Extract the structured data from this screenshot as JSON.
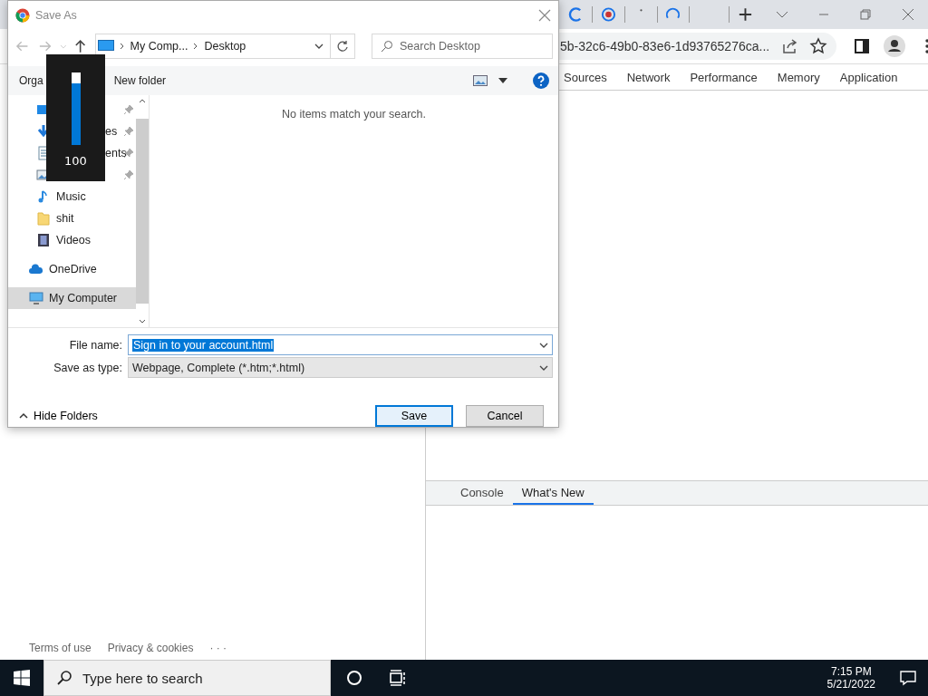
{
  "browser": {
    "url": "5b-32c6-49b0-83e6-1d93765276ca...",
    "devtools_tabs": [
      {
        "label": "Sources",
        "selected": false
      },
      {
        "label": "Network",
        "selected": false
      },
      {
        "label": "Performance",
        "selected": false
      },
      {
        "label": "Memory",
        "selected": false
      },
      {
        "label": "Application",
        "selected": false
      }
    ],
    "drawer_tabs": [
      {
        "label": "Console",
        "selected": false
      },
      {
        "label": "What's New",
        "selected": true
      }
    ],
    "footer_links": [
      "Terms of use",
      "Privacy & cookies",
      "· · ·"
    ]
  },
  "dialog": {
    "title": "Save As",
    "breadcrumb": [
      "My Comp...",
      "Desktop"
    ],
    "search": {
      "placeholder": "Search Desktop"
    },
    "toolbar": {
      "organize": "Orga",
      "new_folder": "New folder"
    },
    "nav_items": [
      {
        "kind": "desktop",
        "pinned": true,
        "selected": false
      },
      {
        "kind": "download",
        "label": "es",
        "pinned": true,
        "selected": false
      },
      {
        "kind": "document",
        "label": "ents",
        "pinned": true,
        "selected": false
      },
      {
        "kind": "pictures",
        "pinned": true,
        "selected": false
      },
      {
        "kind": "music",
        "label": "Music",
        "pinned": false,
        "selected": false
      },
      {
        "kind": "folder",
        "label": "shit",
        "pinned": false,
        "selected": false
      },
      {
        "kind": "videos",
        "label": "Videos",
        "pinned": false,
        "selected": false
      },
      {
        "kind": "cloud",
        "label": "OneDrive",
        "pinned": false,
        "selected": false
      },
      {
        "kind": "computer",
        "label": "My Computer",
        "pinned": false,
        "selected": true
      }
    ],
    "empty_message": "No items match your search.",
    "file_name_label": "File name:",
    "file_name": "Sign in to your account.html",
    "type_label": "Save as type:",
    "type_value": "Webpage, Complete (*.htm;*.html)",
    "hide_folders": "Hide Folders",
    "buttons": [
      "Save",
      "Cancel"
    ]
  },
  "volume": {
    "level": 1,
    "reading": "100"
  },
  "taskbar": {
    "search": {
      "placeholder": "Type here to search"
    },
    "time": "7:15 PM",
    "date": "5/21/2022"
  }
}
